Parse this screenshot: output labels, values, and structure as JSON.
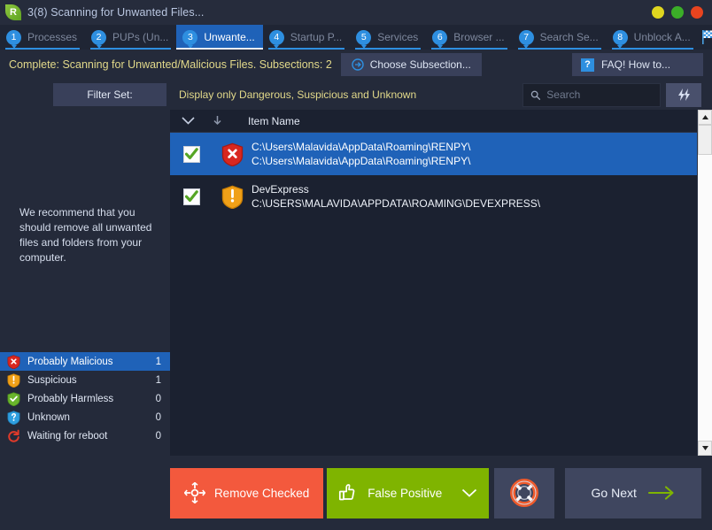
{
  "window": {
    "title": "3(8) Scanning for Unwanted Files...",
    "logo_letter": "R",
    "minimize_label": "Minimize",
    "maximize_label": "Maximize",
    "close_label": "Close",
    "colors": {
      "minimize": "#dfd61f",
      "maximize": "#3bae28",
      "close": "#e8441f",
      "accent_blue": "#2e8fe0",
      "selection_blue": "#1f62b8",
      "warning_yellow": "#e2d98a"
    }
  },
  "tabs": [
    {
      "num": "1",
      "label": "Processes",
      "state": "done"
    },
    {
      "num": "2",
      "label": "PUPs (Un...",
      "state": "done"
    },
    {
      "num": "3",
      "label": "Unwante...",
      "state": "active"
    },
    {
      "num": "4",
      "label": "Startup P...",
      "state": "done"
    },
    {
      "num": "5",
      "label": "Services",
      "state": "done"
    },
    {
      "num": "6",
      "label": "Browser ...",
      "state": "done"
    },
    {
      "num": "7",
      "label": "Search Se...",
      "state": "done"
    },
    {
      "num": "8",
      "label": "Unblock A...",
      "state": "done"
    }
  ],
  "tabs_end_icon": "checkered-flag-icon",
  "status": {
    "text": "Complete: Scanning for Unwanted/Malicious Files. Subsections: 2",
    "choose_subsection_label": "Choose Subsection...",
    "choose_subsection_icon": "arrow-right-circle-icon",
    "faq_label": "FAQ! How to...",
    "faq_badge": "?"
  },
  "filter": {
    "set_label": "Filter Set:",
    "description": "Display only Dangerous, Suspicious and Unknown"
  },
  "search": {
    "placeholder": "Search",
    "value": "",
    "icon": "search-icon",
    "action_icon": "lightning-icon"
  },
  "list": {
    "header": {
      "select_all_icon": "chevron-down-icon",
      "sort_icon": "arrow-down-icon",
      "item_name": "Item Name"
    },
    "rows": [
      {
        "checked": true,
        "severity": "Probably Malicious",
        "severity_icon": "shield-danger-icon",
        "line1": "C:\\Users\\Malavida\\AppData\\Roaming\\RENPY\\",
        "line2": "C:\\Users\\Malavida\\AppData\\Roaming\\RENPY\\",
        "selected": true
      },
      {
        "checked": true,
        "severity": "Suspicious",
        "severity_icon": "shield-warning-icon",
        "line1": "DevExpress",
        "line2": "C:\\USERS\\MALAVIDA\\APPDATA\\ROAMING\\DEVEXPRESS\\",
        "selected": false
      }
    ]
  },
  "sidebar": {
    "recommendation": "We recommend that you should remove all unwanted files and folders from your computer.",
    "legend": [
      {
        "label": "Probably Malicious",
        "count": "1",
        "icon": "shield-danger-icon",
        "selected": true
      },
      {
        "label": "Suspicious",
        "count": "1",
        "icon": "shield-warning-icon",
        "selected": false
      },
      {
        "label": "Probably Harmless",
        "count": "0",
        "icon": "shield-ok-icon",
        "selected": false
      },
      {
        "label": "Unknown",
        "count": "0",
        "icon": "shield-question-icon",
        "selected": false
      },
      {
        "label": "Waiting for reboot",
        "count": "0",
        "icon": "reboot-icon",
        "selected": false
      }
    ]
  },
  "footer": {
    "remove_checked_label": "Remove Checked",
    "remove_checked_icon": "crosshair-icon",
    "false_positive_label": "False Positive",
    "false_positive_icon": "thumbs-up-icon",
    "false_positive_caret": "chevron-down-icon",
    "help_icon": "lifebuoy-icon",
    "go_next_label": "Go Next",
    "go_next_icon": "arrow-right-icon",
    "colors": {
      "remove": "#f3593d",
      "false_positive": "#7fb400",
      "next_arrow": "#7fb400"
    }
  },
  "scrollbar": {
    "up_label": "Scroll up",
    "down_label": "Scroll down",
    "thumb_label": "Scroll thumb"
  }
}
